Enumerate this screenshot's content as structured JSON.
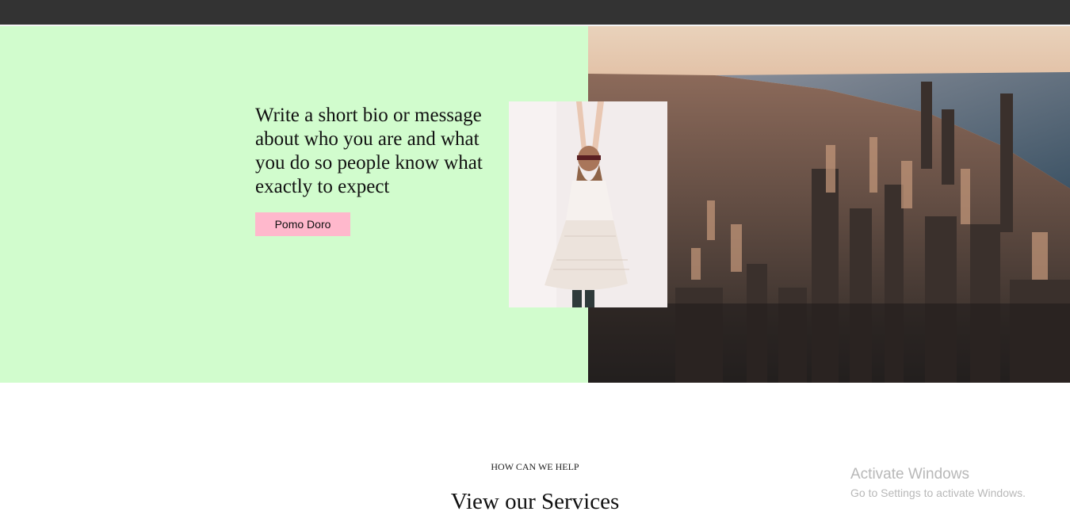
{
  "hero": {
    "bio_text": "Write a short bio or message about who you are and what you do so people know what exactly to expect",
    "button_label": "Pomo Doro",
    "background_color": "#d1fccd",
    "button_color": "#ffb8cc"
  },
  "services": {
    "eyebrow": "HOW CAN WE HELP",
    "title": "View our Services"
  },
  "watermark": {
    "title": "Activate Windows",
    "subtitle": "Go to Settings to activate Windows."
  }
}
